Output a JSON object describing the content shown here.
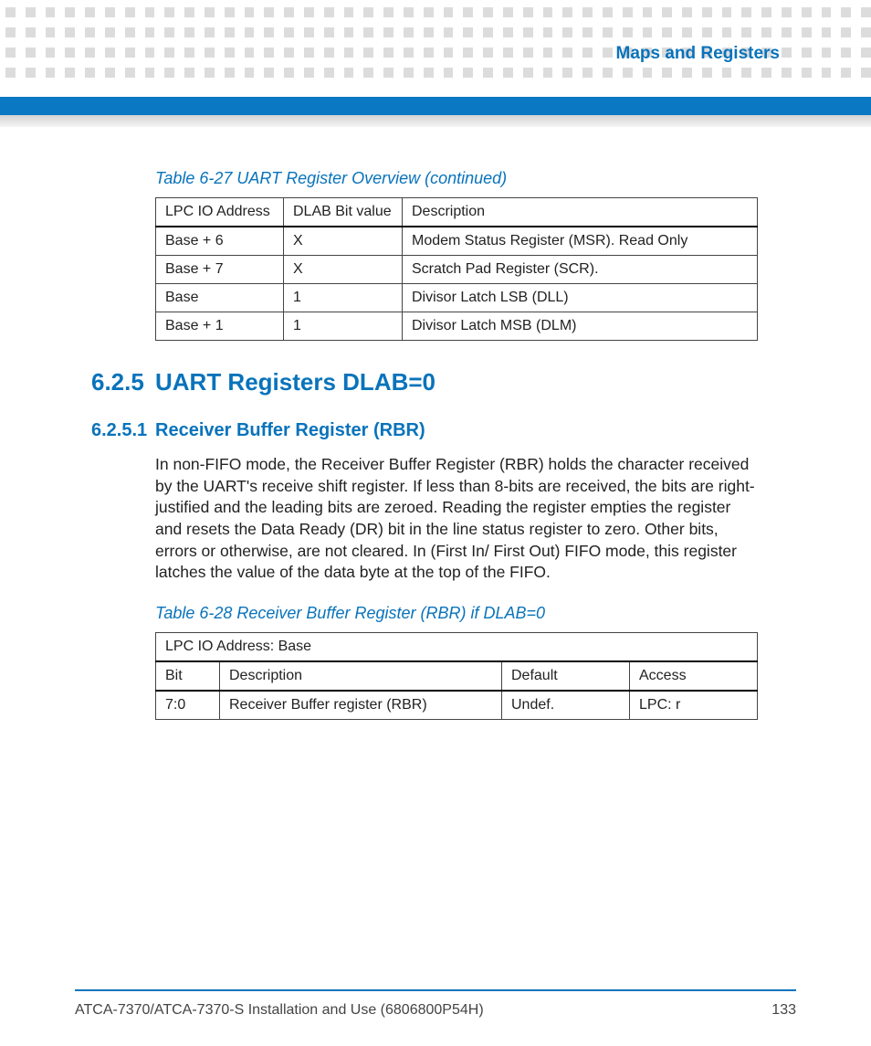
{
  "header": {
    "chapter_title": "Maps and Registers"
  },
  "table1": {
    "caption": "Table 6-27 UART Register Overview  (continued)",
    "headers": {
      "c1": "LPC IO Address",
      "c2": "DLAB Bit value",
      "c3": "Description"
    },
    "rows": [
      {
        "c1": "Base + 6",
        "c2": "X",
        "c3": "Modem Status Register (MSR). Read Only"
      },
      {
        "c1": "Base + 7",
        "c2": "X",
        "c3": "Scratch Pad Register (SCR)."
      },
      {
        "c1": "Base",
        "c2": "1",
        "c3": "Divisor Latch LSB (DLL)"
      },
      {
        "c1": "Base + 1",
        "c2": "1",
        "c3": "Divisor Latch MSB (DLM)"
      }
    ]
  },
  "section1": {
    "num": "6.2.5",
    "title": "UART Registers DLAB=0"
  },
  "section2": {
    "num": "6.2.5.1",
    "title": "Receiver Buffer Register (RBR)"
  },
  "paragraph1": "In non-FIFO mode, the Receiver Buffer Register (RBR) holds the character received by the UART's receive shift register. If less than 8-bits are received, the bits are right-justified and the leading bits are zeroed. Reading the register empties the register and resets the Data Ready (DR) bit in the line status register to zero. Other bits, errors or otherwise, are not cleared. In (First In/ First Out) FIFO mode, this register latches the value of the data byte at the top of the FIFO.",
  "table2": {
    "caption": "Table 6-28 Receiver Buffer Register (RBR) if DLAB=0",
    "header_row": "LPC IO Address: Base",
    "headers": {
      "c1": "Bit",
      "c2": "Description",
      "c3": "Default",
      "c4": "Access"
    },
    "rows": [
      {
        "c1": "7:0",
        "c2": "Receiver Buffer register (RBR)",
        "c3": "Undef.",
        "c4": "LPC: r"
      }
    ]
  },
  "footer": {
    "doc_title": "ATCA-7370/ATCA-7370-S Installation and Use (6806800P54H)",
    "page_number": "133"
  }
}
